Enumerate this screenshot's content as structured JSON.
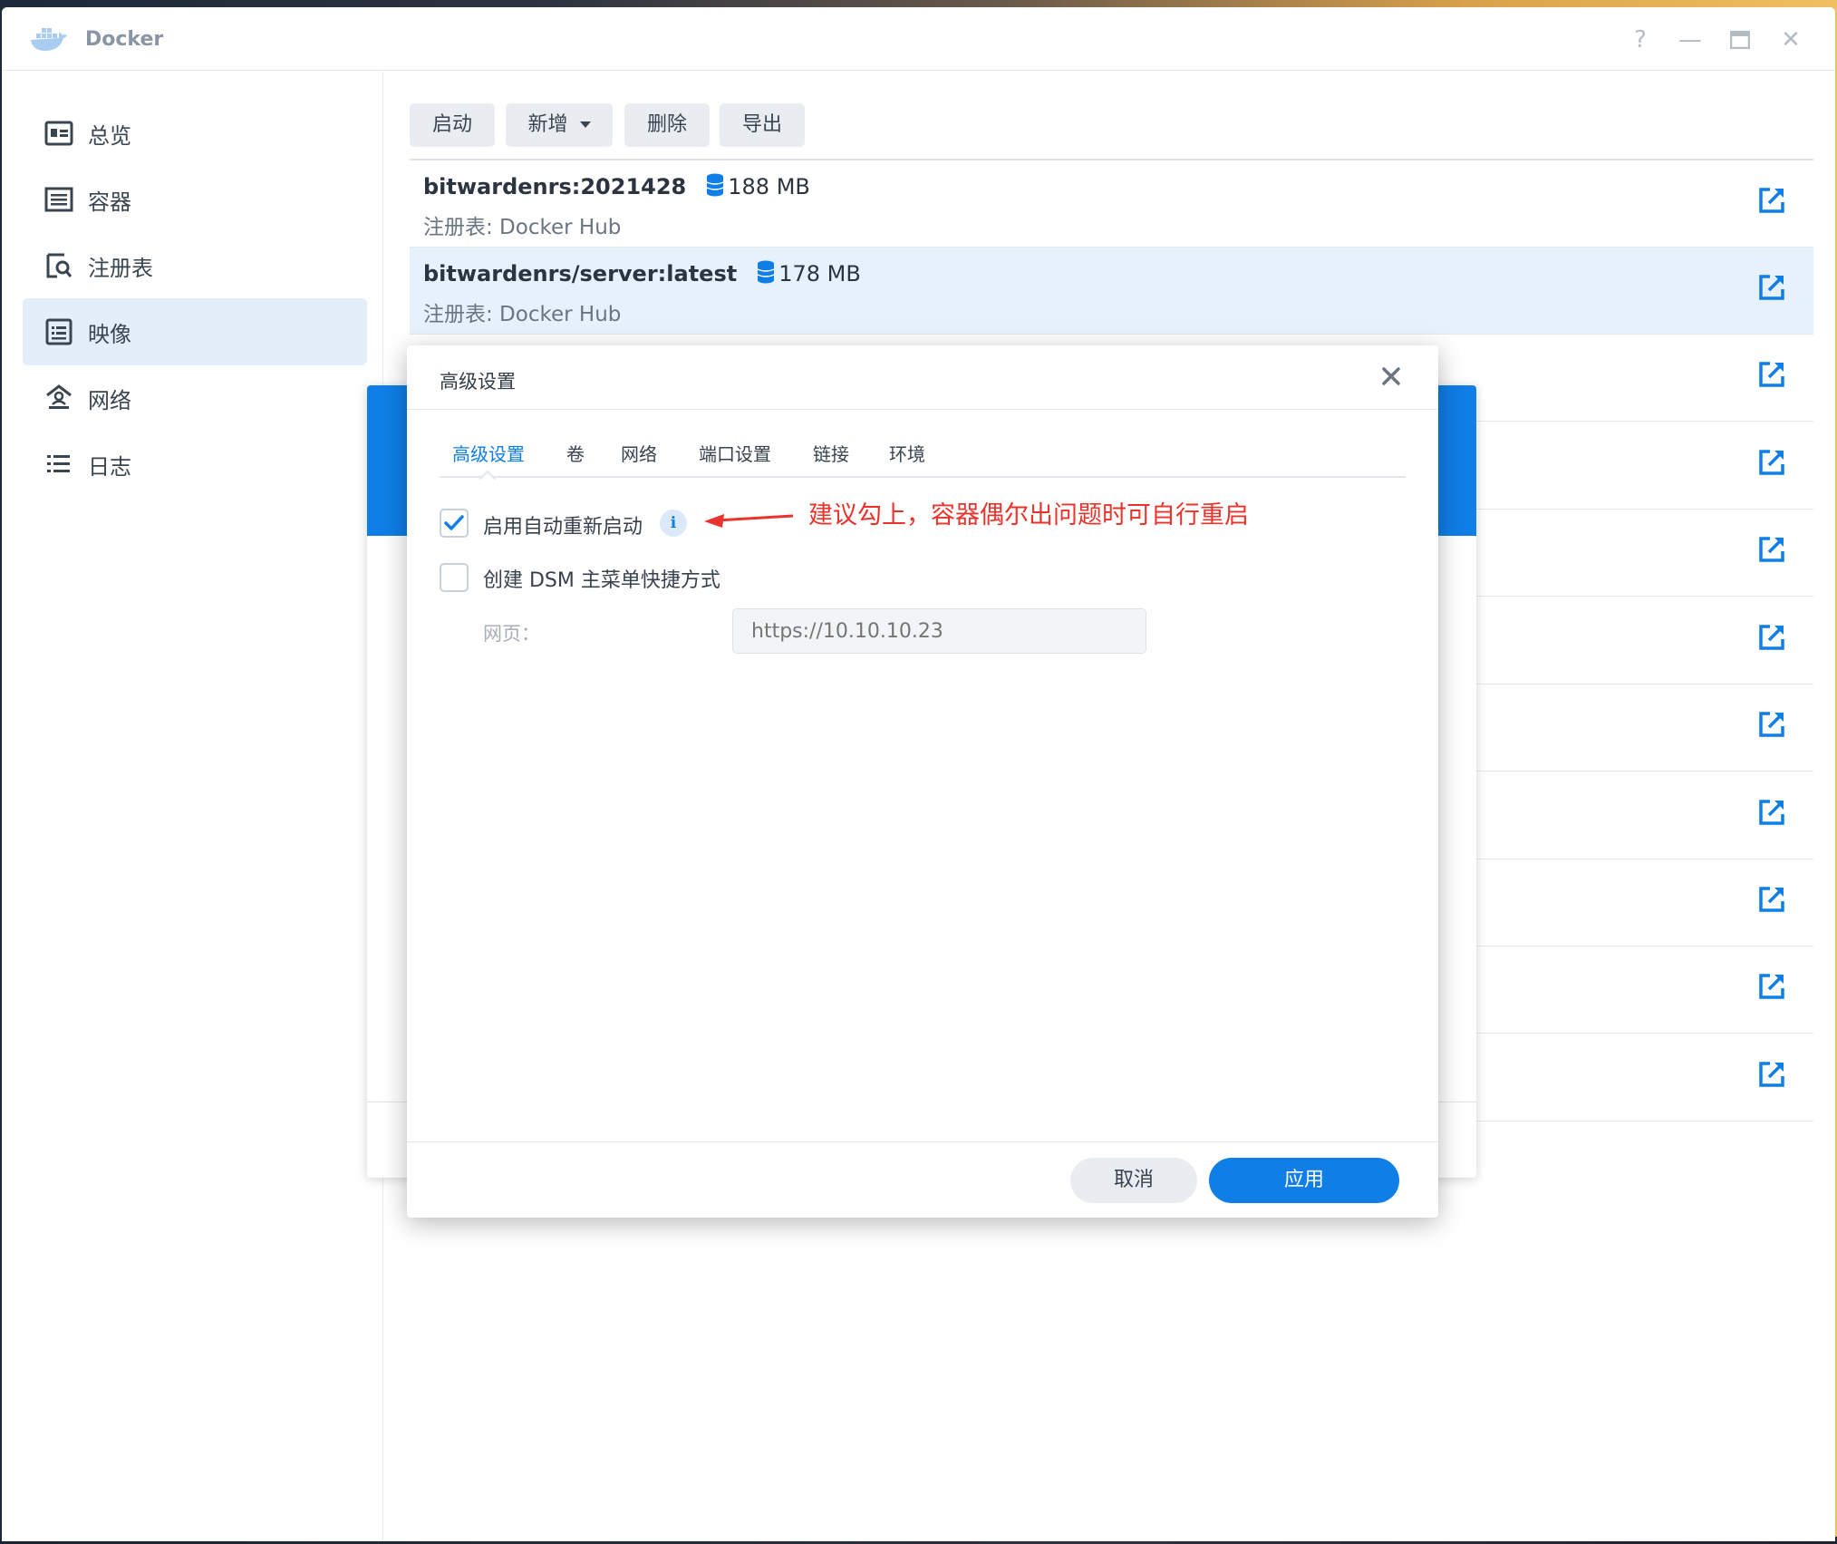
{
  "window": {
    "title": "Docker",
    "controls": {
      "help": "?",
      "minimize": "—",
      "maximize": "▭",
      "close": "✕"
    }
  },
  "sidebar": {
    "items": [
      {
        "label": "总览",
        "icon": "overview-icon",
        "active": false
      },
      {
        "label": "容器",
        "icon": "container-icon",
        "active": false
      },
      {
        "label": "注册表",
        "icon": "registry-icon",
        "active": false
      },
      {
        "label": "映像",
        "icon": "image-icon",
        "active": true
      },
      {
        "label": "网络",
        "icon": "network-icon",
        "active": false
      },
      {
        "label": "日志",
        "icon": "log-icon",
        "active": false
      }
    ]
  },
  "toolbar": {
    "start_label": "启动",
    "add_label": "新增",
    "delete_label": "删除",
    "export_label": "导出"
  },
  "images": [
    {
      "name": "bitwardenrs:2021428",
      "size": "188 MB",
      "registry": "注册表: Docker Hub"
    },
    {
      "name": "bitwardenrs/server:latest",
      "size": "178 MB",
      "registry": "注册表: Docker Hub"
    }
  ],
  "dialog": {
    "title": "高级设置",
    "tabs": [
      {
        "label": "高级设置",
        "active": true
      },
      {
        "label": "卷",
        "active": false
      },
      {
        "label": "网络",
        "active": false
      },
      {
        "label": "端口设置",
        "active": false
      },
      {
        "label": "链接",
        "active": false
      },
      {
        "label": "环境",
        "active": false
      }
    ],
    "auto_restart": {
      "label": "启用自动重新启动",
      "checked": true
    },
    "annotation": "建议勾上，容器偶尔出问题时可自行重启",
    "shortcut": {
      "label": "创建 DSM 主菜单快捷方式",
      "checked": false
    },
    "webpage": {
      "label": "网页：",
      "placeholder": "https://10.10.10.23"
    },
    "cancel_label": "取消",
    "apply_label": "应用"
  },
  "colors": {
    "accent": "#0f7ee6",
    "annotation": "#e8342c",
    "selected_row": "#e6f1fc"
  }
}
